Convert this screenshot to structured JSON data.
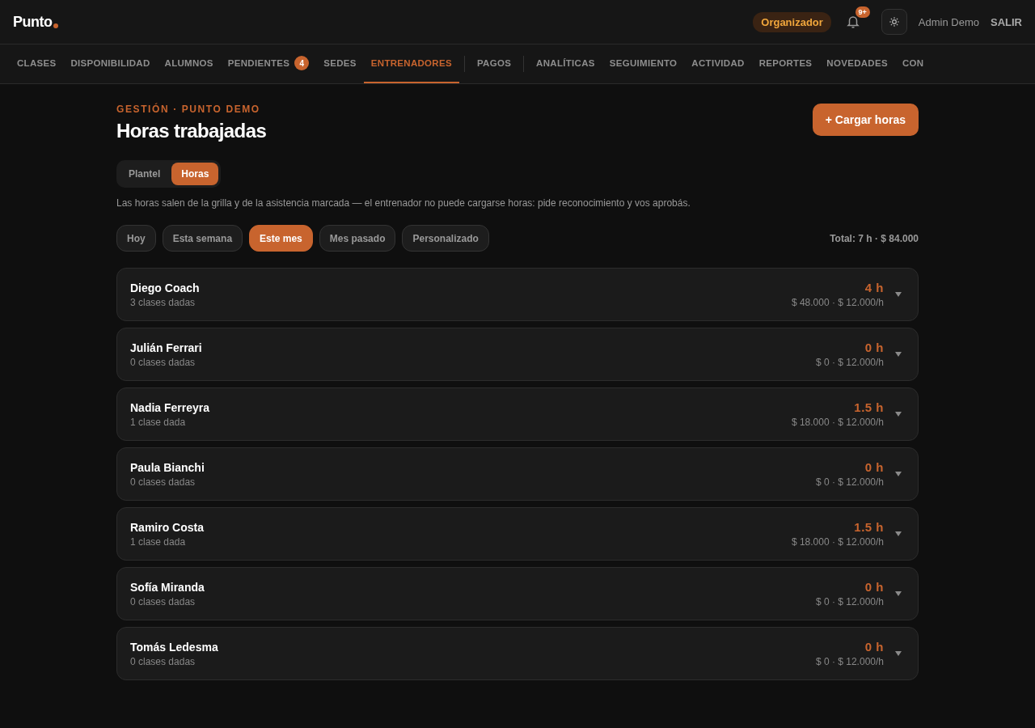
{
  "header": {
    "logo": "Punto",
    "role_badge": "Organizador",
    "notifications_badge": "9+",
    "user": "Admin Demo",
    "logout": "SALIR"
  },
  "nav": [
    {
      "label": "CLASES",
      "selected": false
    },
    {
      "label": "DISPONIBILIDAD",
      "selected": false
    },
    {
      "label": "ALUMNOS",
      "selected": false
    },
    {
      "label": "PENDIENTES",
      "selected": false,
      "badge": "4"
    },
    {
      "label": "SEDES",
      "selected": false
    },
    {
      "label": "ENTRENADORES",
      "selected": true,
      "divider_after": true
    },
    {
      "label": "PAGOS",
      "selected": false,
      "divider_after": true
    },
    {
      "label": "ANALÍTICAS",
      "selected": false
    },
    {
      "label": "SEGUIMIENTO",
      "selected": false
    },
    {
      "label": "ACTIVIDAD",
      "selected": false
    },
    {
      "label": "REPORTES",
      "selected": false
    },
    {
      "label": "NOVEDADES",
      "selected": false
    },
    {
      "label": "CON",
      "selected": false
    }
  ],
  "page": {
    "eyebrow": "GESTIÓN · PUNTO DEMO",
    "title": "Horas trabajadas",
    "action": "+ Cargar horas",
    "view_toggle": [
      {
        "label": "Plantel",
        "selected": false
      },
      {
        "label": "Horas",
        "selected": true
      }
    ],
    "note": "Las horas salen de la grilla y de la asistencia marcada — el entrenador no puede cargarse horas: pide reconocimiento y vos aprobás.",
    "periods": [
      {
        "label": "Hoy",
        "selected": false
      },
      {
        "label": "Esta semana",
        "selected": false
      },
      {
        "label": "Este mes",
        "selected": true
      },
      {
        "label": "Mes pasado",
        "selected": false
      },
      {
        "label": "Personalizado",
        "selected": false
      }
    ],
    "total": "Total: 7 h · $ 84.000"
  },
  "trainers": [
    {
      "name": "Diego Coach",
      "classes": "3 clases dadas",
      "hours": "4 h",
      "amount": "$ 48.000 · $ 12.000/h"
    },
    {
      "name": "Julián Ferrari",
      "classes": "0 clases dadas",
      "hours": "0 h",
      "amount": "$ 0 · $ 12.000/h"
    },
    {
      "name": "Nadia Ferreyra",
      "classes": "1 clase dada",
      "hours": "1.5 h",
      "amount": "$ 18.000 · $ 12.000/h"
    },
    {
      "name": "Paula Bianchi",
      "classes": "0 clases dadas",
      "hours": "0 h",
      "amount": "$ 0 · $ 12.000/h"
    },
    {
      "name": "Ramiro Costa",
      "classes": "1 clase dada",
      "hours": "1.5 h",
      "amount": "$ 18.000 · $ 12.000/h"
    },
    {
      "name": "Sofía Miranda",
      "classes": "0 clases dadas",
      "hours": "0 h",
      "amount": "$ 0 · $ 12.000/h"
    },
    {
      "name": "Tomás Ledesma",
      "classes": "0 clases dadas",
      "hours": "0 h",
      "amount": "$ 0 · $ 12.000/h"
    }
  ]
}
